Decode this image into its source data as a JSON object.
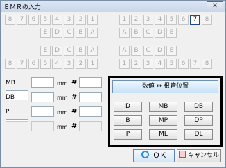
{
  "window": {
    "title": "ＥＭＲの入力",
    "close_label": "✕"
  },
  "upper_right_teeth": [
    "8",
    "7",
    "6",
    "5",
    "4",
    "3",
    "2",
    "1"
  ],
  "upper_left_teeth": [
    "1",
    "2",
    "3",
    "4",
    "5",
    "6",
    "7",
    "8"
  ],
  "upper_right_deciduous": [
    "E",
    "D",
    "C",
    "B",
    "A"
  ],
  "upper_left_deciduous": [
    "A",
    "B",
    "C",
    "D",
    "E"
  ],
  "lower_right_deciduous": [
    "E",
    "D",
    "C",
    "B",
    "A"
  ],
  "lower_left_deciduous": [
    "A",
    "B",
    "C",
    "D",
    "E"
  ],
  "lower_right_teeth": [
    "8",
    "7",
    "6",
    "5",
    "4",
    "3",
    "2",
    "1"
  ],
  "lower_left_teeth": [
    "1",
    "2",
    "3",
    "4",
    "5",
    "6",
    "7",
    "8"
  ],
  "measurements": [
    {
      "label": "MB",
      "unit": "mm",
      "hash": "#"
    },
    {
      "label": "DB",
      "unit": "mm",
      "hash": "#"
    },
    {
      "label": "P",
      "unit": "mm",
      "hash": "#"
    },
    {
      "label": "",
      "unit": "mm",
      "hash": "#"
    }
  ],
  "panel": {
    "convert_button": "数値 ↔ 根管位置",
    "root_buttons": [
      "D",
      "MB",
      "DB",
      "B",
      "MP",
      "DP",
      "P",
      "ML",
      "DL"
    ]
  },
  "footer": {
    "ok_label": "ＯＫ",
    "cancel_label": "キャンセル"
  },
  "selected_tooth": "7"
}
